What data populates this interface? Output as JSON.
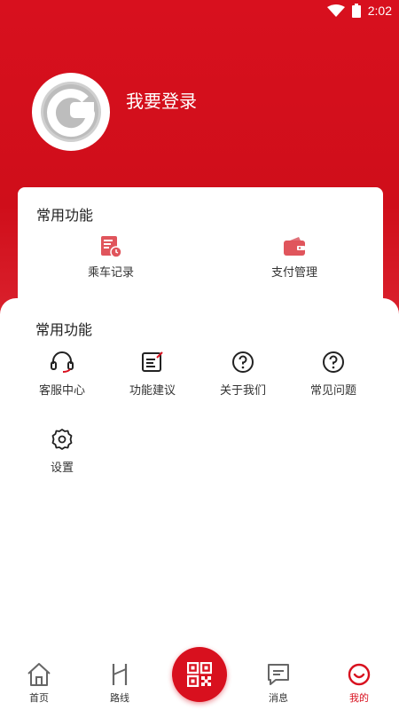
{
  "status_bar": {
    "time": "2:02",
    "wifi_icon": "wifi-icon",
    "battery_icon": "battery-icon"
  },
  "profile": {
    "login_label": "我要登录",
    "avatar_icon": "avatar-g-logo-icon"
  },
  "common_card": {
    "title": "常用功能",
    "items": [
      {
        "label": "乘车记录",
        "icon": "ride-record-icon"
      },
      {
        "label": "支付管理",
        "icon": "wallet-icon"
      }
    ]
  },
  "functions_sheet": {
    "title": "常用功能",
    "items": [
      {
        "label": "客服中心",
        "icon": "headset-icon"
      },
      {
        "label": "功能建议",
        "icon": "edit-note-icon"
      },
      {
        "label": "关于我们",
        "icon": "question-circle-icon"
      },
      {
        "label": "常见问题",
        "icon": "question-circle-icon"
      },
      {
        "label": "设置",
        "icon": "gear-icon"
      }
    ]
  },
  "tabbar": {
    "tabs": [
      {
        "label": "首页",
        "icon": "home-icon"
      },
      {
        "label": "路线",
        "icon": "route-icon"
      },
      {
        "label": "消息",
        "icon": "message-icon"
      },
      {
        "label": "我的",
        "icon": "smile-icon"
      }
    ],
    "active_tab": "我的",
    "center_button_icon": "qr-code-icon"
  },
  "colors": {
    "brand_red": "#d8101e",
    "text": "#222222",
    "icon_gray": "#777777"
  }
}
